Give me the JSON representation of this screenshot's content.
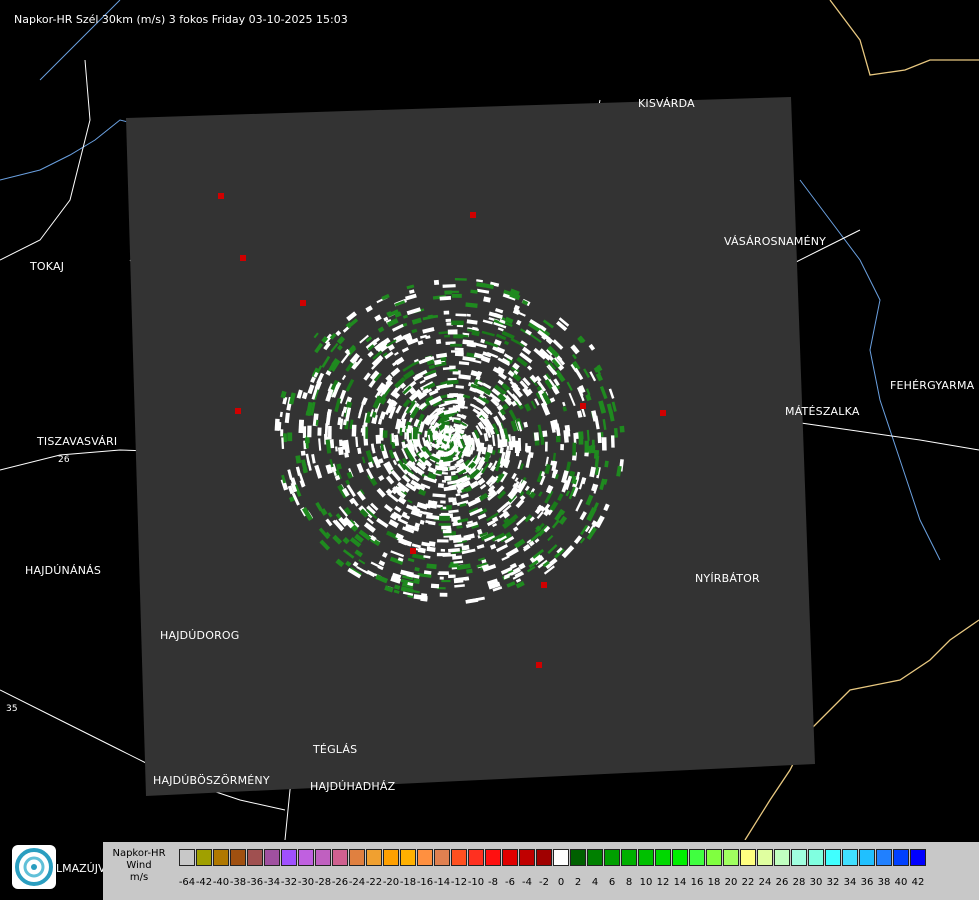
{
  "title": "Napkor-HR Szél 30km (m/s) 3 fokos Friday 03-10-2025 15:03",
  "cities": [
    {
      "name": "KISVÁRDA",
      "key": "kisvarda"
    },
    {
      "name": "TOKAJ",
      "key": "tokaj"
    },
    {
      "name": "VÁSÁROSNAMÉNY",
      "key": "vasarosnameny"
    },
    {
      "name": "FEHÉRGYARMA",
      "key": "fehergyarmat"
    },
    {
      "name": "MÁTÉSZALKA",
      "key": "mateszalka"
    },
    {
      "name": "TISZAVASVÁRI",
      "key": "tiszavasvari"
    },
    {
      "name": "HAJDÚNÁNÁS",
      "key": "hajdunanas"
    },
    {
      "name": "NYÍRBÁTOR",
      "key": "nyirbator"
    },
    {
      "name": "HAJDÚDOROG",
      "key": "hajdudorog"
    },
    {
      "name": "TÉGLÁS",
      "key": "teglas"
    },
    {
      "name": "HAJDÚBÖSZÖRMÉNY",
      "key": "hajduboszormeny"
    },
    {
      "name": "HAJDÚHADHÁZ",
      "key": "hajduhadhaz"
    }
  ],
  "road_numbers": [
    "26",
    "35"
  ],
  "logo_text": "LMAZÚJVÁR",
  "legend": {
    "line1": "Napkor-HR",
    "line2": "Wind",
    "line3": "m/s",
    "colors": [
      "#c8c8c8",
      "#a0a000",
      "#b07800",
      "#a05010",
      "#a05050",
      "#a050a0",
      "#a050ff",
      "#c060e0",
      "#c060c0",
      "#d06090",
      "#e08040",
      "#f0a030",
      "#ffa000",
      "#ffb000",
      "#ff9040",
      "#e08050",
      "#ff5020",
      "#ff3020",
      "#ff1010",
      "#e00000",
      "#c00000",
      "#a00000",
      "#ffffff",
      "#006000",
      "#008000",
      "#00a000",
      "#00b000",
      "#00c000",
      "#00d800",
      "#00f000",
      "#40ff40",
      "#80ff40",
      "#a0ff60",
      "#ffff80",
      "#e0ffa0",
      "#c0ffc0",
      "#a0ffe0",
      "#80ffe0",
      "#40ffff",
      "#40e0ff",
      "#20c0ff",
      "#2080ff",
      "#0040ff",
      "#0000ff"
    ],
    "ticks": [
      "-64",
      "-42",
      "-40",
      "-38",
      "-36",
      "-34",
      "-32",
      "-30",
      "-28",
      "-26",
      "-24",
      "-22",
      "-20",
      "-18",
      "-16",
      "-14",
      "-12",
      "-10",
      "-8",
      "-6",
      "-4",
      "-2",
      "0",
      "2",
      "4",
      "6",
      "8",
      "10",
      "12",
      "14",
      "16",
      "18",
      "20",
      "22",
      "24",
      "26",
      "28",
      "30",
      "32",
      "34",
      "36",
      "38",
      "40",
      "42"
    ]
  },
  "accent": {
    "border": "#e8c880",
    "river": "#6aa0e0",
    "coverage": "#333333"
  }
}
